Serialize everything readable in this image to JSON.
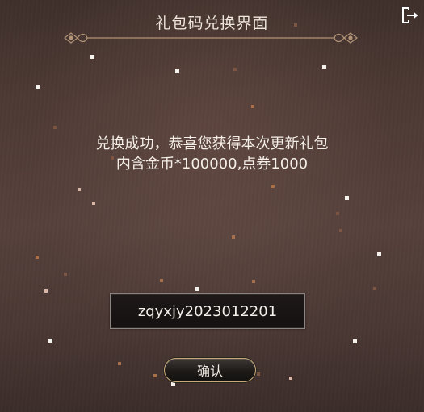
{
  "window": {
    "title": "礼包码兑换界面",
    "exit_icon": "exit-icon"
  },
  "result": {
    "line1": "兑换成功，恭喜您获得本次更新礼包",
    "line2": "内含金币*100000,点券1000"
  },
  "redeem": {
    "code_value": "zqyxjy2023012201",
    "confirm_label": "确认"
  },
  "colors": {
    "gold_accent": "#c8aa7a",
    "text": "#f4efe8"
  }
}
